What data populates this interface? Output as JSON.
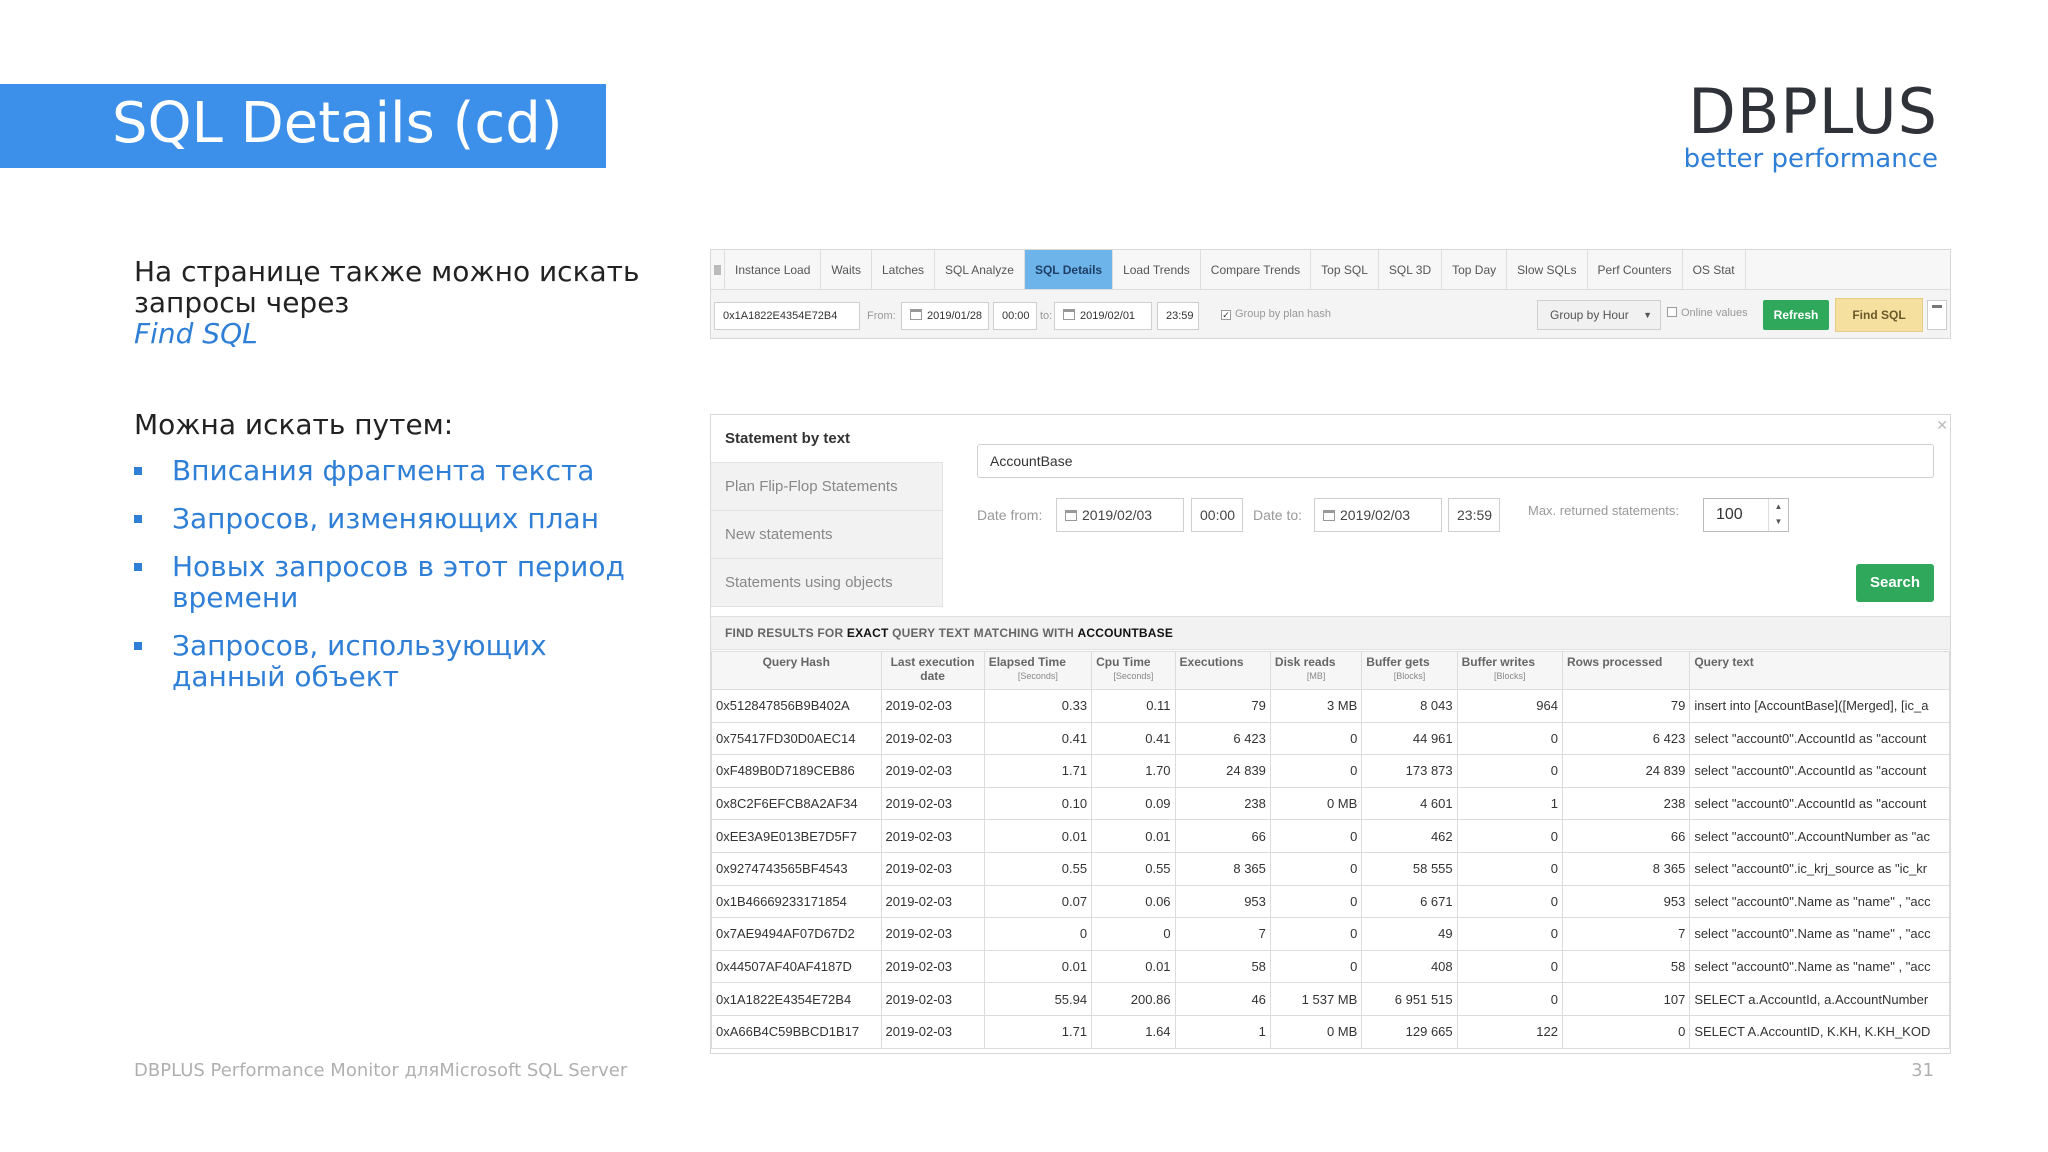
{
  "slide": {
    "title": "SQL Details (cd)",
    "logo": {
      "main": "DBPLUS",
      "sub": "better performance"
    },
    "intro_text": "На странице также можно искать запросы через",
    "intro_link": "Find SQL",
    "methods_title": "Можна искать путем:",
    "bullets": [
      "Вписания фрагмента текста",
      "Запросов, изменяющих план",
      "Новых запросов в этот период времени",
      "Запросов, использующих данный объект"
    ],
    "footer_left": "DBPLUS Performance Monitor дляMicrosoft SQL Server",
    "page_number": "31",
    "accent_color": "#3d90ea"
  },
  "toolbar": {
    "tabs": [
      "Instance Load",
      "Waits",
      "Latches",
      "SQL Analyze",
      "SQL Details",
      "Load Trends",
      "Compare Trends",
      "Top SQL",
      "SQL 3D",
      "Top Day",
      "Slow SQLs",
      "Perf Counters",
      "OS Stat"
    ],
    "active_tab": "SQL Details",
    "hash_value": "0x1A1822E4354E72B4",
    "from_label": "From:",
    "from_date": "2019/01/28",
    "from_time": "00:00",
    "to_label": "to:",
    "to_date": "2019/02/01",
    "to_time": "23:59",
    "group_by_plan_hash": "Group by plan hash",
    "group_by_select": "Group by Hour",
    "online_values": "Online values",
    "refresh_label": "Refresh",
    "find_sql_label": "Find SQL"
  },
  "find_panel": {
    "menu": [
      "Statement by text",
      "Plan Flip-Flop Statements",
      "New statements",
      "Statements using objects"
    ],
    "active_menu": "Statement by text",
    "search_text": "AccountBase",
    "date_from_label": "Date from:",
    "date_from": "2019/02/03",
    "time_from": "00:00",
    "date_to_label": "Date to:",
    "date_to": "2019/02/03",
    "time_to": "23:59",
    "max_label": "Max. returned statements:",
    "max_value": "100",
    "search_button": "Search",
    "results_prefix": "FIND RESULTS FOR",
    "results_mode": "EXACT",
    "results_middle": "QUERY TEXT MATCHING WITH",
    "results_term": "ACCOUNTBASE"
  },
  "results_table": {
    "columns": [
      {
        "label": "Query Hash",
        "unit": ""
      },
      {
        "label": "Last execution date",
        "unit": ""
      },
      {
        "label": "Elapsed Time",
        "unit": "[Seconds]"
      },
      {
        "label": "Cpu Time",
        "unit": "[Seconds]"
      },
      {
        "label": "Executions",
        "unit": ""
      },
      {
        "label": "Disk reads",
        "unit": "[MB]"
      },
      {
        "label": "Buffer gets",
        "unit": "[Blocks]"
      },
      {
        "label": "Buffer writes",
        "unit": "[Blocks]"
      },
      {
        "label": "Rows processed",
        "unit": ""
      },
      {
        "label": "Query text",
        "unit": ""
      }
    ],
    "rows": [
      [
        "0x512847856B9B402A",
        "2019-02-03",
        "0.33",
        "0.11",
        "79",
        "3 MB",
        "8 043",
        "964",
        "79",
        "insert into [AccountBase]([Merged], [ic_a"
      ],
      [
        "0x75417FD30D0AEC14",
        "2019-02-03",
        "0.41",
        "0.41",
        "6 423",
        "0",
        "44 961",
        "0",
        "6 423",
        "select \"account0\".AccountId as \"account"
      ],
      [
        "0xF489B0D7189CEB86",
        "2019-02-03",
        "1.71",
        "1.70",
        "24 839",
        "0",
        "173 873",
        "0",
        "24 839",
        "select \"account0\".AccountId as \"account"
      ],
      [
        "0x8C2F6EFCB8A2AF34",
        "2019-02-03",
        "0.10",
        "0.09",
        "238",
        "0 MB",
        "4 601",
        "1",
        "238",
        "select \"account0\".AccountId as \"account"
      ],
      [
        "0xEE3A9E013BE7D5F7",
        "2019-02-03",
        "0.01",
        "0.01",
        "66",
        "0",
        "462",
        "0",
        "66",
        "select \"account0\".AccountNumber as \"ac"
      ],
      [
        "0x9274743565BF4543",
        "2019-02-03",
        "0.55",
        "0.55",
        "8 365",
        "0",
        "58 555",
        "0",
        "8 365",
        "select \"account0\".ic_krj_source as \"ic_kr"
      ],
      [
        "0x1B46669233171854",
        "2019-02-03",
        "0.07",
        "0.06",
        "953",
        "0",
        "6 671",
        "0",
        "953",
        "select \"account0\".Name as \"name\" , \"acc"
      ],
      [
        "0x7AE9494AF07D67D2",
        "2019-02-03",
        "0",
        "0",
        "7",
        "0",
        "49",
        "0",
        "7",
        "select \"account0\".Name as \"name\" , \"acc"
      ],
      [
        "0x44507AF40AF4187D",
        "2019-02-03",
        "0.01",
        "0.01",
        "58",
        "0",
        "408",
        "0",
        "58",
        "select \"account0\".Name as \"name\" , \"acc"
      ],
      [
        "0x1A1822E4354E72B4",
        "2019-02-03",
        "55.94",
        "200.86",
        "46",
        "1 537 MB",
        "6 951 515",
        "0",
        "107",
        "SELECT a.AccountId, a.AccountNumber"
      ],
      [
        "0xA66B4C59BBCD1B17",
        "2019-02-03",
        "1.71",
        "1.64",
        "1",
        "0 MB",
        "129 665",
        "122",
        "0",
        "SELECT A.AccountID, K.KH, K.KH_KOD"
      ]
    ]
  }
}
